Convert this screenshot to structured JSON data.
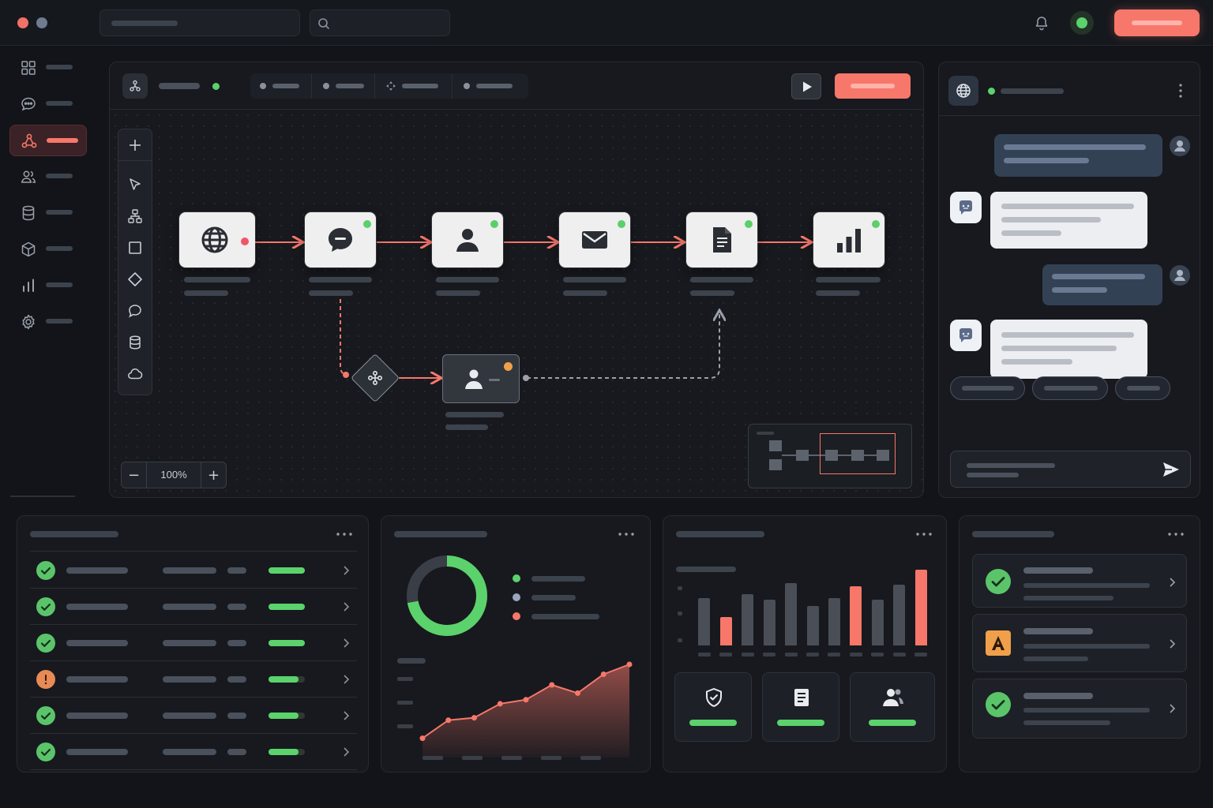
{
  "canvas": {
    "zoom_label": "100%",
    "zoom_out": "−",
    "zoom_in": "+"
  },
  "colors": {
    "accent": "#f7776b",
    "success": "#5bd26c",
    "warning": "#f0a04a",
    "bg": "#121419",
    "panel": "#17191e",
    "node": "#efefef",
    "user_bubble": "#334155"
  },
  "icons": {
    "sidebar": [
      "grid-icon",
      "chat-icon",
      "workflow-icon",
      "users-icon",
      "database-icon",
      "cube-icon",
      "bar-chart-icon",
      "gear-icon"
    ],
    "flow_nodes": [
      "globe-icon",
      "message-icon",
      "user-icon",
      "mail-icon",
      "document-icon",
      "bar-chart-icon"
    ],
    "tools": [
      "plus-icon",
      "pointer-icon",
      "hierarchy-icon",
      "square-icon",
      "diamond-icon",
      "speech-icon",
      "database-icon",
      "cloud-icon"
    ],
    "stats": [
      "shield-check-icon",
      "clipboard-icon",
      "users-icon"
    ]
  },
  "widgets": {
    "donut_fraction": 0.72,
    "table_progress": [
      0.85,
      0.85,
      0.85,
      0.7,
      0.7,
      0.7
    ],
    "table_status": [
      "ok",
      "ok",
      "ok",
      "warning",
      "ok",
      "ok"
    ],
    "bars": [
      {
        "h": 0.62,
        "accent": false
      },
      {
        "h": 0.38,
        "accent": true
      },
      {
        "h": 0.68,
        "accent": false
      },
      {
        "h": 0.6,
        "accent": false
      },
      {
        "h": 0.82,
        "accent": false
      },
      {
        "h": 0.52,
        "accent": false
      },
      {
        "h": 0.62,
        "accent": false
      },
      {
        "h": 0.78,
        "accent": true
      },
      {
        "h": 0.6,
        "accent": false
      },
      {
        "h": 0.8,
        "accent": false
      },
      {
        "h": 1.0,
        "accent": true
      }
    ],
    "trend": [
      0.1,
      0.32,
      0.35,
      0.52,
      0.57,
      0.75,
      0.65,
      0.88,
      1.0
    ]
  }
}
